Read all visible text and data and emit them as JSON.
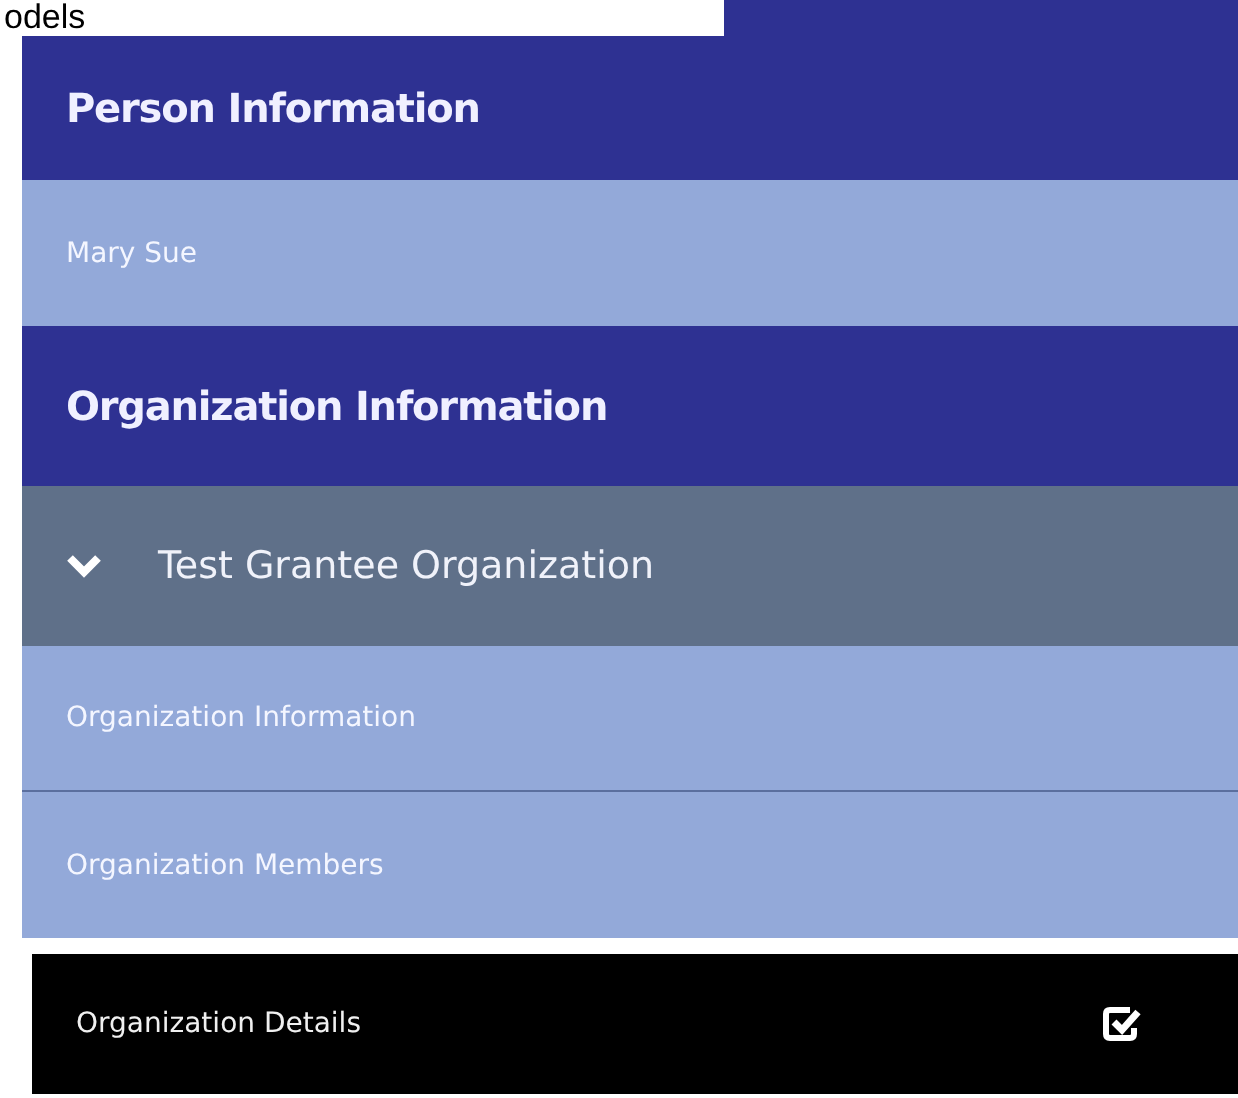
{
  "page_heading": "odels",
  "sections": [
    {
      "title": "Person Information",
      "items": [
        {
          "kind": "link",
          "label": "Mary Sue",
          "selected": false
        }
      ]
    },
    {
      "title": "Organization Information",
      "items": [
        {
          "kind": "group",
          "label": "Test Grantee Organization",
          "expanded": true
        },
        {
          "kind": "link",
          "label": "Organization Information",
          "selected": false
        },
        {
          "kind": "link",
          "label": "Organization Members",
          "selected": false
        },
        {
          "kind": "link",
          "label": "Organization Details",
          "selected": true
        }
      ]
    }
  ]
}
